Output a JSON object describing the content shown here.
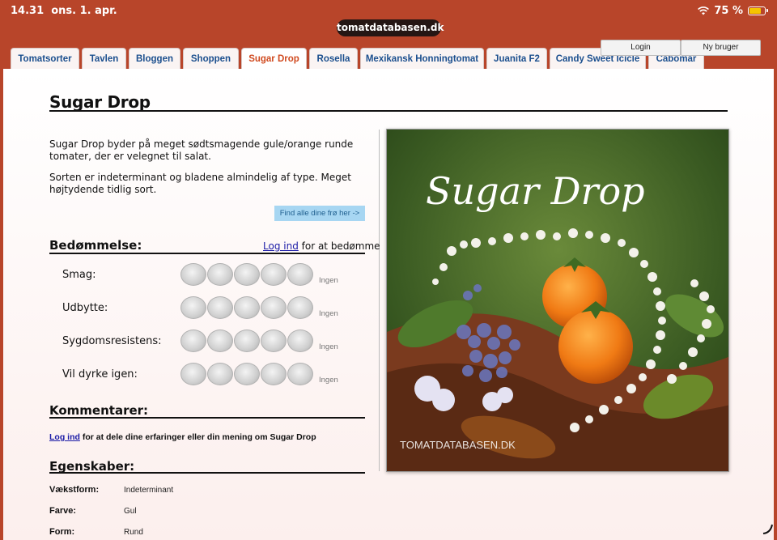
{
  "status_bar": {
    "time": "14.31",
    "date": "ons. 1. apr.",
    "battery": "75 %",
    "battery_level": 0.75,
    "battery_color": "#f5c400"
  },
  "url": "tomatdatabasen.dk",
  "tabs": [
    {
      "label": "Tomatsorter"
    },
    {
      "label": "Tavlen"
    },
    {
      "label": "Bloggen"
    },
    {
      "label": "Shoppen"
    },
    {
      "label": "Sugar Drop",
      "active": true
    },
    {
      "label": "Rosella"
    },
    {
      "label": "Mexikansk Honningtomat"
    },
    {
      "label": "Juanita F2"
    },
    {
      "label": "Candy Sweet Icicle"
    },
    {
      "label": "Cabomar"
    }
  ],
  "user_menu": {
    "login": "Login",
    "new_user": "Ny bruger"
  },
  "page_title": "Sugar Drop",
  "description": [
    "Sugar Drop byder på meget sødtsmagende gule/orange runde tomater, der er velegnet til salat.",
    "Sorten er indeterminant og bladene almindelig af type. Meget højtydende tidlig sort."
  ],
  "find_seeds_button": "Find alle dine frø her ->",
  "rating": {
    "heading": "Bedømmelse:",
    "login_link": "Log ind",
    "login_suffix": " for at bedømme",
    "rows": [
      {
        "label": "Smag:",
        "value": "Ingen"
      },
      {
        "label": "Udbytte:",
        "value": "Ingen"
      },
      {
        "label": "Sygdomsresistens:",
        "value": "Ingen"
      },
      {
        "label": "Vil dyrke igen:",
        "value": "Ingen"
      }
    ]
  },
  "comments": {
    "heading": "Kommentarer:",
    "login_link": "Log ind",
    "text": " for at dele dine erfaringer eller din mening om Sugar Drop"
  },
  "properties": {
    "heading": "Egenskaber:",
    "rows": [
      {
        "label": "Vækstform:",
        "value": "Indeterminant"
      },
      {
        "label": "Farve:",
        "value": "Gul"
      },
      {
        "label": "Form:",
        "value": "Rund"
      }
    ]
  },
  "photo": {
    "title": "Sugar Drop",
    "watermark": "TOMATDATABASEN.DK"
  },
  "colors": {
    "brand": "#b8452a",
    "tab_text": "#1b4f8e",
    "active_tab_text": "#d04a1f",
    "link": "#1a1aa6",
    "find_button": "#a7d6f2"
  }
}
